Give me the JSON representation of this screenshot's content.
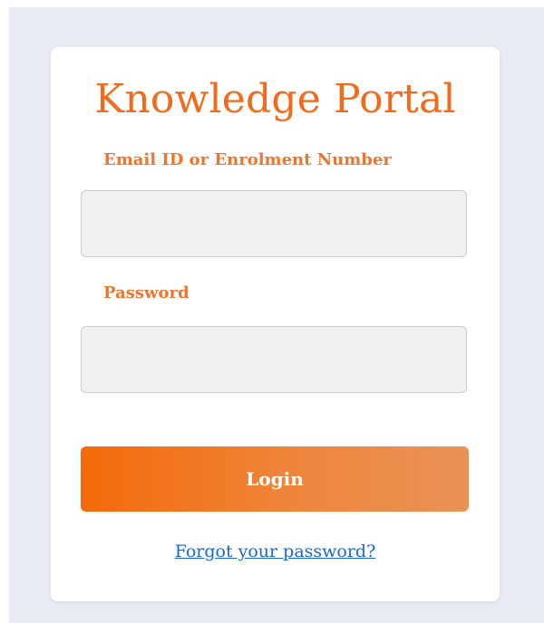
{
  "login_form": {
    "title": "Knowledge Portal",
    "email_label": "Email ID or Enrolment Number",
    "email_value": "",
    "password_label": "Password",
    "password_value": "",
    "login_button": "Login",
    "forgot_password_link": "Forgot your password?"
  },
  "colors": {
    "accent": "#f26a1b",
    "button_gradient_start": "#f46a0a",
    "button_gradient_end": "#e99257",
    "link": "#1a66d6",
    "background": "#e8ebf4"
  }
}
